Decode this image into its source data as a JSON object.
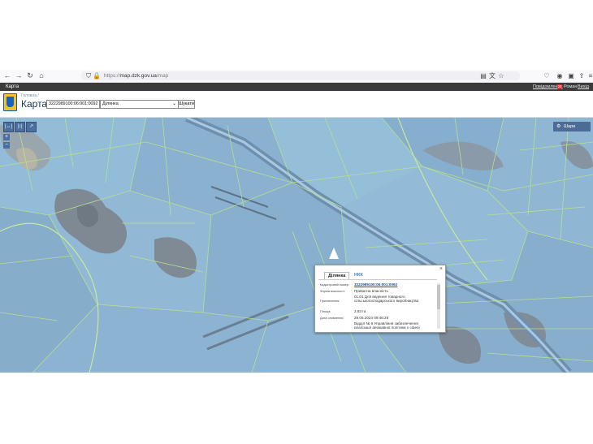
{
  "browser": {
    "url_prefix": "https://",
    "url_domain": "map.dzk.gov.ua",
    "url_path": "/map"
  },
  "site": {
    "header_title": "Карта",
    "notifications_label": "Повідомлення",
    "notifications_count": "28",
    "user_label": "Роман",
    "exit_label": "Вихід"
  },
  "page": {
    "breadcrumb": "Головна /",
    "title": "Карта",
    "search_value": "3222989100:06:001:0092",
    "search_type": "Ділянка",
    "find_label": "Шукати"
  },
  "map": {
    "layers_label": "Шари",
    "zoom_in": "+",
    "zoom_out": "−",
    "tools": [
      "|↔|",
      "|↕|",
      "↗"
    ]
  },
  "popup": {
    "tabs": [
      "Ділянка",
      "НКК"
    ],
    "active_tab": "Ділянка",
    "close": "×",
    "rows": [
      {
        "label": "Кадастровий номер:",
        "value": "3222989100:06:001:0092",
        "link": true
      },
      {
        "label": "Форма власності:",
        "value": "Приватна власність"
      },
      {
        "label": "Призначення:",
        "value": "01.01 Для ведення товарного сільськогосподарського виробництва"
      },
      {
        "label": "Площа:",
        "value": "2.83 га"
      },
      {
        "label": "Дата оновлення:",
        "value": "29.05.2024 09:46:28"
      },
      {
        "label": "",
        "value": "Відділ № 6 Управління забезпечення реалізації державної політики у сфері"
      }
    ]
  },
  "colors": {
    "map_base": "#8db6d6",
    "parcel_line": "#b7e08c",
    "dark_bar": "#3b3b3b"
  }
}
